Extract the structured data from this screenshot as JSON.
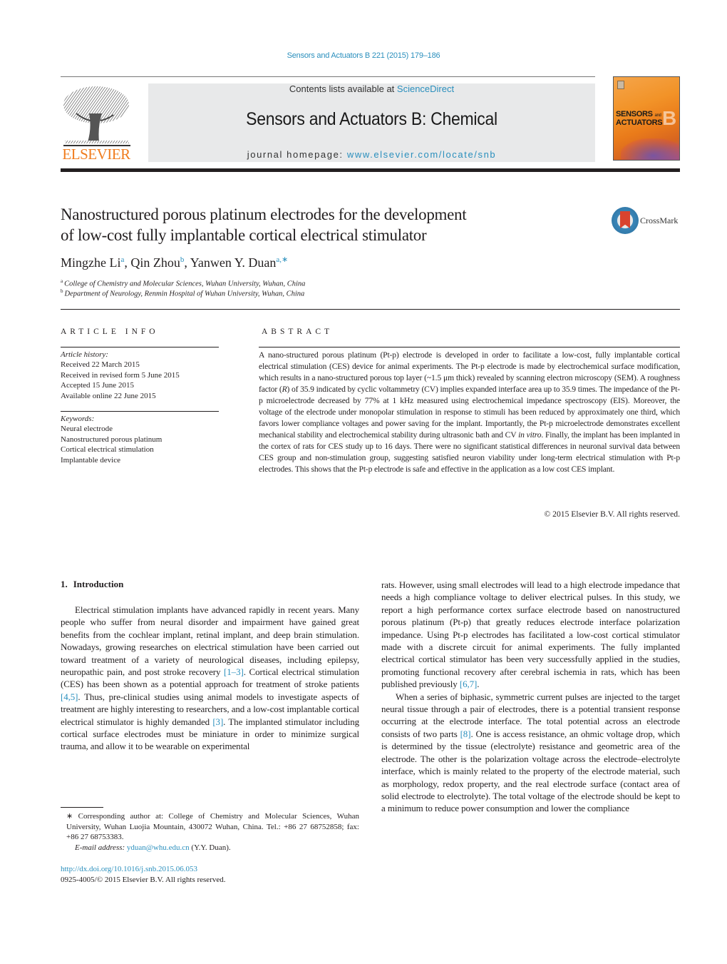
{
  "header": {
    "citation": "Sensors and Actuators B 221 (2015) 179–186",
    "contents_prefix": "Contents lists available at ",
    "contents_link": "ScienceDirect",
    "journal_title": "Sensors and Actuators B: Chemical",
    "homepage_prefix": "journal homepage: ",
    "homepage_link": "www.elsevier.com/locate/snb",
    "publisher_logo_text": "ELSEVIER",
    "cover": {
      "line1": "SENSORS",
      "line1_small": "and",
      "line2": "ACTUATORS",
      "letter": "B"
    },
    "colors": {
      "link": "#2a8fbd",
      "elsevier_orange": "#f07c1e",
      "box_gray": "#e8e9ea"
    }
  },
  "article": {
    "title_line1": "Nanostructured porous platinum electrodes for the development",
    "title_line2": "of low-cost fully implantable cortical electrical stimulator",
    "crossmark_label": "CrossMark",
    "authors": [
      {
        "name": "Mingzhe Li",
        "sup": "a"
      },
      {
        "name": "Qin Zhou",
        "sup": "b"
      },
      {
        "name": "Yanwen Y. Duan",
        "sup": "a,∗"
      }
    ],
    "affiliations": [
      {
        "sup": "a",
        "text": "College of Chemistry and Molecular Sciences, Wuhan University, Wuhan, China"
      },
      {
        "sup": "b",
        "text": "Department of Neurology, Renmin Hospital of Wuhan University, Wuhan, China"
      }
    ]
  },
  "article_info": {
    "heading": "ARTICLE INFO",
    "history_label": "Article history:",
    "history": [
      "Received 22 March 2015",
      "Received in revised form 5 June 2015",
      "Accepted 15 June 2015",
      "Available online 22 June 2015"
    ],
    "keywords_label": "Keywords:",
    "keywords": [
      "Neural electrode",
      "Nanostructured porous platinum",
      "Cortical electrical stimulation",
      "Implantable device"
    ]
  },
  "abstract": {
    "heading": "ABSTRACT",
    "text_part1": "A nano-structured porous platinum (Pt-p) electrode is developed in order to facilitate a low-cost, fully implantable cortical electrical stimulation (CES) device for animal experiments. The Pt-p electrode is made by electrochemical surface modification, which results in a nano-structured porous top layer (~1.5 μm thick) revealed by scanning electron microscopy (SEM). A roughness factor (",
    "text_R": "R",
    "text_part2": ") of 35.9 indicated by cyclic voltammetry (CV) implies expanded interface area up to 35.9 times. The impedance of the Pt-p microelectrode decreased by 77% at 1 kHz measured using electrochemical impedance spectroscopy (EIS). Moreover, the voltage of the electrode under monopolar stimulation in response to stimuli has been reduced by approximately one third, which favors lower compliance voltages and power saving for the implant. Importantly, the Pt-p microelectrode demonstrates excellent mechanical stability and electrochemical stability during ultrasonic bath and CV ",
    "text_invitro": "in vitro",
    "text_part3": ". Finally, the implant has been implanted in the cortex of rats for CES study up to 16 days. There were no significant statistical differences in neuronal survival data between CES group and non-stimulation group, suggesting satisfied neuron viability under long-term electrical stimulation with Pt-p electrodes. This shows that the Pt-p electrode is safe and effective in the application as a low cost CES implant.",
    "copyright": "© 2015 Elsevier B.V. All rights reserved."
  },
  "introduction": {
    "number": "1.",
    "heading": "Introduction",
    "left_p1_a": "Electrical stimulation implants have advanced rapidly in recent years. Many people who suffer from neural disorder and impairment have gained great benefits from the cochlear implant, retinal implant, and deep brain stimulation. Nowadays, growing researches on electrical stimulation have been carried out toward treatment of a variety of neurological diseases, including epilepsy, neuropathic pain, and post stroke recovery ",
    "ref_1_3": "[1–3]",
    "left_p1_b": ". Cortical electrical stimulation (CES) has been shown as a potential approach for treatment of stroke patients ",
    "ref_4_5": "[4,5]",
    "left_p1_c": ". Thus, pre-clinical studies using animal models to investigate aspects of treatment are highly interesting to researchers, and a low-cost implantable cortical electrical stimulator is highly demanded ",
    "ref_3": "[3]",
    "left_p1_d": ". The implanted stimulator including cortical surface electrodes must be miniature in order to minimize surgical trauma, and allow it to be wearable on experimental",
    "right_p1_a": "rats. However, using small electrodes will lead to a high electrode impedance that needs a high compliance voltage to deliver electrical pulses. In this study, we report a high performance cortex surface electrode based on nanostructured porous platinum (Pt-p) that greatly reduces electrode interface polarization impedance. Using Pt-p electrodes has facilitated a low-cost cortical stimulator made with a discrete circuit for animal experiments. The fully implanted electrical cortical stimulator has been very successfully applied in the studies, promoting functional recovery after cerebral ischemia in rats, which has been published previously ",
    "ref_6_7": "[6,7]",
    "right_p1_b": ".",
    "right_p2_a": "When a series of biphasic, symmetric current pulses are injected to the target neural tissue through a pair of electrodes, there is a potential transient response occurring at the electrode interface. The total potential across an electrode consists of two parts ",
    "ref_8": "[8]",
    "right_p2_b": ". One is access resistance, an ohmic voltage drop, which is determined by the tissue (electrolyte) resistance and geometric area of the electrode. The other is the polarization voltage across the electrode–electrolyte interface, which is mainly related to the property of the electrode material, such as morphology, redox property, and the real electrode surface (contact area of solid electrode to electrolyte). The total voltage of the electrode should be kept to a minimum to reduce power consumption and lower the compliance"
  },
  "footnote": {
    "corresponding": "∗ Corresponding author at: College of Chemistry and Molecular Sciences, Wuhan University, Wuhan Luojia Mountain, 430072 Wuhan, China. Tel.: +86 27 68752858; fax: +86 27 68753383.",
    "email_label": "E-mail address:",
    "email": "yduan@whu.edu.cn",
    "email_suffix": " (Y.Y. Duan).",
    "doi": "http://dx.doi.org/10.1016/j.snb.2015.06.053",
    "issn": "0925-4005/© 2015 Elsevier B.V. All rights reserved."
  }
}
